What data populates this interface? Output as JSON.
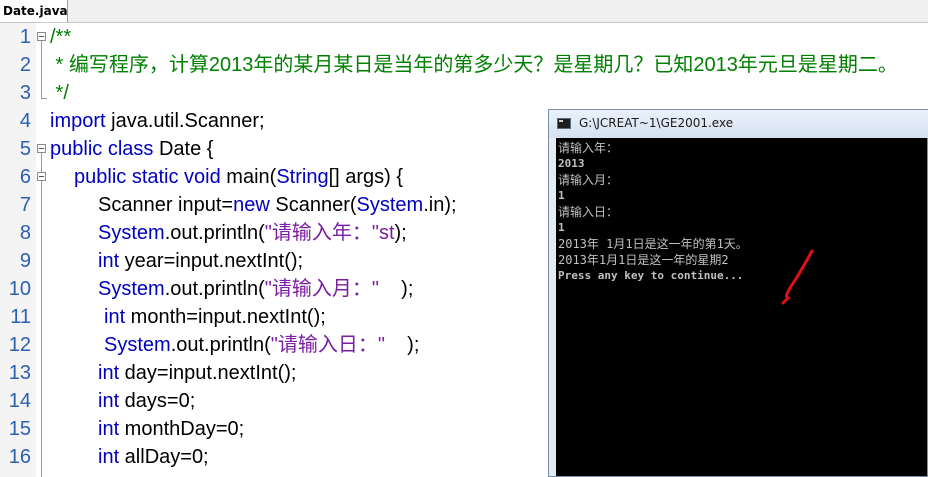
{
  "tab": {
    "label": "Date.java"
  },
  "editor": {
    "lines": [
      {
        "n": "1",
        "t": "/**"
      },
      {
        "n": "2",
        "t": " * 编写程序，计算2013年的某月某日是当年的第多少天？是星期几？已知2013年元旦是星期二。"
      },
      {
        "n": "3",
        "t": " */"
      },
      {
        "n": "4",
        "k": "import",
        "t": " java.util.Scanner;"
      },
      {
        "n": "5",
        "k": "public class",
        "t": " Date {"
      },
      {
        "n": "6",
        "k": "public static void",
        "t": " main(",
        "c": "String",
        "r": "[] args) {"
      },
      {
        "n": "7",
        "t": "Scanner input=",
        "k": "new",
        "r": " Scanner(",
        "c": "System",
        "s": ".in);"
      },
      {
        "n": "8",
        "c": "System",
        "t": ".out.println(",
        "q": "\"请输入年：\"st",
        "r": ");"
      },
      {
        "n": "9",
        "k": "int",
        "t": " year=input.nextInt();"
      },
      {
        "n": "10",
        "c": "System",
        "t": ".out.println(",
        "q": "\"请输入月：\"",
        "r": "    );"
      },
      {
        "n": "11",
        "k": "int",
        "t": " month=input.nextInt();"
      },
      {
        "n": "12",
        "c": "System",
        "t": ".out.println(",
        "q": "\"请输入日：\"",
        "r": "    );"
      },
      {
        "n": "13",
        "k": "int",
        "t": " day=input.nextInt();"
      },
      {
        "n": "14",
        "k": "int",
        "t": " days=0;"
      },
      {
        "n": "15",
        "k": "int",
        "t": " monthDay=0;"
      },
      {
        "n": "16",
        "k": "int",
        "t": " allDay=0;"
      }
    ]
  },
  "console": {
    "title": "G:\\JCREAT~1\\GE2001.exe",
    "lines": [
      "请输入年：",
      "2013",
      "请输入月：",
      "1",
      "请输入日：",
      "1",
      "2013年 1月1日是这一年的第1天。",
      "2013年1月1日是这一年的星期2",
      "Press any key to continue..."
    ]
  },
  "colors": {
    "keyword": "#0000c0",
    "comment": "#008000",
    "string": "#7b1fa2",
    "annotation_mark": "#e01010"
  }
}
